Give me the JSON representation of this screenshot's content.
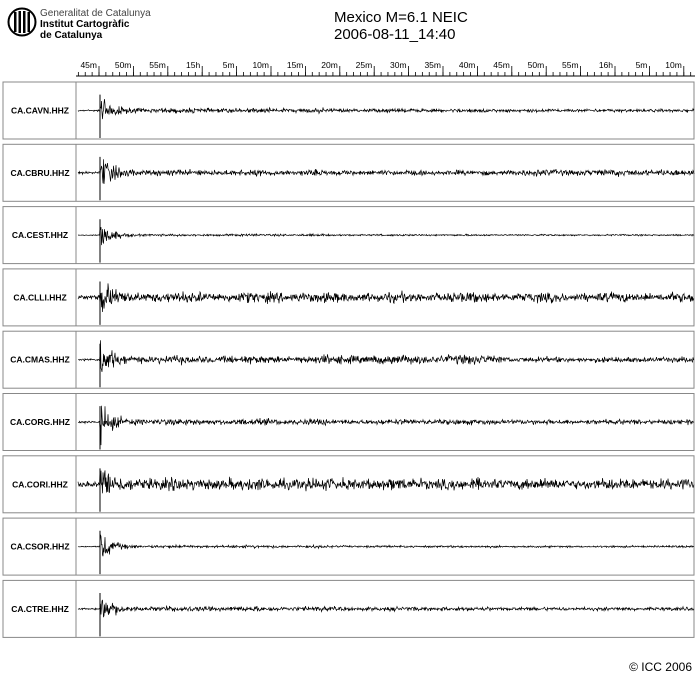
{
  "header": {
    "institution_line1": "Generalitat de Catalunya",
    "institution_line2": "Institut Cartogràfic",
    "institution_line3": "de Catalunya",
    "title": "Mexico M=6.1 NEIC",
    "subtitle": "2006-08-11_14:40"
  },
  "footer": {
    "copyright": "© ICC 2006"
  },
  "chart_data": {
    "type": "line",
    "title": "Mexico M=6.1 NEIC",
    "subtitle": "2006-08-11_14:40",
    "time_axis": {
      "tick_labels": [
        "45m",
        "50m",
        "55m",
        "15h",
        "5m",
        "10m",
        "15m",
        "20m",
        "25m",
        "30m",
        "35m",
        "40m",
        "45m",
        "50m",
        "55m",
        "16h",
        "5m",
        "10m"
      ],
      "label_interval_minutes": 5,
      "minor_tick_interval_minutes": 1
    },
    "traces": [
      {
        "station": "CA.CAVN.HHZ",
        "noise": 0.22,
        "onset_amp": 1.0,
        "coda": [
          0.3,
          0.2,
          0.15
        ]
      },
      {
        "station": "CA.CBRU.HHZ",
        "noise": 0.32,
        "onset_amp": 1.0,
        "coda": [
          0.35,
          0.25,
          0.4
        ]
      },
      {
        "station": "CA.CEST.HHZ",
        "noise": 0.1,
        "onset_amp": 0.9,
        "coda": [
          0.15,
          0.1,
          0.08
        ]
      },
      {
        "station": "CA.CLLI.HHZ",
        "noise": 0.55,
        "onset_amp": 1.0,
        "coda": [
          0.6,
          0.55,
          0.5
        ]
      },
      {
        "station": "CA.CMAS.HHZ",
        "noise": 0.3,
        "onset_amp": 1.0,
        "coda": [
          0.55,
          0.7,
          0.3
        ]
      },
      {
        "station": "CA.CORG.HHZ",
        "noise": 0.3,
        "onset_amp": 1.0,
        "coda": [
          0.4,
          0.3,
          0.25
        ]
      },
      {
        "station": "CA.CORI.HHZ",
        "noise": 0.65,
        "onset_amp": 1.0,
        "coda": [
          0.7,
          0.65,
          0.6
        ]
      },
      {
        "station": "CA.CSOR.HHZ",
        "noise": 0.12,
        "onset_amp": 0.95,
        "coda": [
          0.2,
          0.12,
          0.1
        ]
      },
      {
        "station": "CA.CTRE.HHZ",
        "noise": 0.2,
        "onset_amp": 1.0,
        "coda": [
          0.35,
          0.25,
          0.2
        ]
      }
    ]
  }
}
